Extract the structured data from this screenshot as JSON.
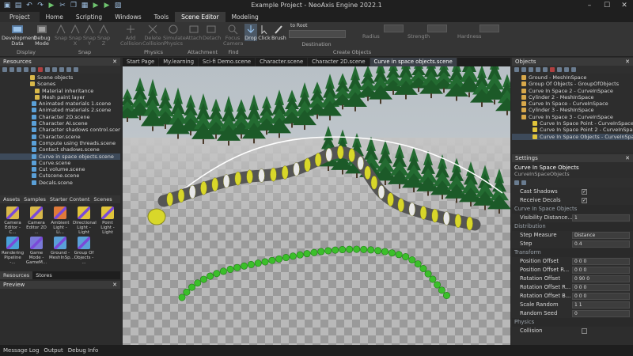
{
  "window": {
    "title": "Example Project - NeoAxis Engine 2022.1"
  },
  "menu": [
    "Project",
    "Home",
    "Scripting",
    "Windows",
    "Tools",
    "Scene Editor",
    "Modeling"
  ],
  "ribbon": {
    "buttons": [
      "Development Data",
      "Debug Mode",
      "Snap",
      "Snap X",
      "Snap Y",
      "Snap Z",
      "Add Collision",
      "Delete Collision",
      "Simulate Physics",
      "Attach",
      "Detach",
      "Focus Camera",
      "Drop",
      "Click",
      "Brush"
    ],
    "destination_value": "to Root",
    "radius_label": "Radius",
    "strength_label": "Strength",
    "hardness_label": "Hardness",
    "groups": [
      "Display",
      "Snap",
      "Physics",
      "Attachment",
      "Find",
      "Destination",
      "Create Objects"
    ]
  },
  "resources": {
    "title": "Resources",
    "items": [
      {
        "label": "Scene objects",
        "kind": "folder"
      },
      {
        "label": "Scenes",
        "kind": "folder"
      },
      {
        "label": "Material inheritance",
        "kind": "folder"
      },
      {
        "label": "Mesh paint layer",
        "kind": "folder"
      },
      {
        "label": "Animated materials 1.scene",
        "kind": "scene"
      },
      {
        "label": "Animated materials 2.scene",
        "kind": "scene"
      },
      {
        "label": "Character 2D.scene",
        "kind": "scene"
      },
      {
        "label": "Character AI.scene",
        "kind": "scene"
      },
      {
        "label": "Character shadows control.scene",
        "kind": "scene"
      },
      {
        "label": "Character.scene",
        "kind": "scene"
      },
      {
        "label": "Compute using threads.scene",
        "kind": "scene"
      },
      {
        "label": "Contact shadows.scene",
        "kind": "scene"
      },
      {
        "label": "Curve in space objects.scene",
        "kind": "scene",
        "selected": true
      },
      {
        "label": "Curve.scene",
        "kind": "scene"
      },
      {
        "label": "Cut volume.scene",
        "kind": "scene"
      },
      {
        "label": "Cutscene.scene",
        "kind": "scene"
      },
      {
        "label": "Decals.scene",
        "kind": "scene"
      }
    ],
    "asset_tabs": [
      "Assets",
      "Samples",
      "Starter Content",
      "Scenes"
    ],
    "assets": [
      {
        "label": "Camera Editor - C..."
      },
      {
        "label": "Camera Editor 2D ..."
      },
      {
        "label": "Ambient Light - Li..."
      },
      {
        "label": "Directional Light - Light"
      },
      {
        "label": "Point Light - Light"
      },
      {
        "label": "Rendering Pipeline -..."
      },
      {
        "label": "Game Mode - GameM..."
      },
      {
        "label": "Ground - MeshInSp..."
      },
      {
        "label": "Group Of Objects - ..."
      }
    ],
    "bottom_tabs": [
      "Resources",
      "Stores"
    ],
    "preview_title": "Preview"
  },
  "doc_tabs": [
    "Start Page",
    "My.learning",
    "Sci-fi Demo.scene",
    "Character.scene",
    "Character 2D.scene",
    "Curve in space objects.scene"
  ],
  "objects": {
    "title": "Objects",
    "items": [
      "Ground - MeshInSpace",
      "Group Of Objects - GroupOfObjects",
      "Curve In Space 2 - CurveInSpace",
      "Cylinder 2 - MeshInSpace",
      "Curve In Space - CurveInSpace",
      "Cylinder 3 - MeshInSpace",
      "Curve In Space 3 - CurveInSpace",
      "Curve In Space Point - CurveInSpacePoint",
      "Curve In Space Point 2 - CurveInSpacePoint",
      "Curve In Space Objects - CurveInSpaceObjects"
    ]
  },
  "settings": {
    "title": "Settings",
    "object_name": "Curve In Space Objects",
    "object_type": "CurveInSpaceObjects",
    "rows": [
      {
        "kind": "check",
        "label": "Cast Shadows",
        "value": "✓"
      },
      {
        "kind": "check",
        "label": "Receive Decals",
        "value": "✓"
      },
      {
        "kind": "cat",
        "label": "Curve In Space Objects"
      },
      {
        "kind": "val",
        "label": "Visibility Distance...",
        "value": "1"
      },
      {
        "kind": "cat",
        "label": "Distribution"
      },
      {
        "kind": "val",
        "label": "Step Measure",
        "value": "Distance"
      },
      {
        "kind": "val",
        "label": "Step",
        "value": "0.4"
      },
      {
        "kind": "cat",
        "label": "Transform"
      },
      {
        "kind": "val",
        "label": "Position Offset",
        "value": "0 0 0"
      },
      {
        "kind": "val",
        "label": "Position Offset R...",
        "value": "0 0 0"
      },
      {
        "kind": "val",
        "label": "Rotation Offset",
        "value": "0 90 0"
      },
      {
        "kind": "val",
        "label": "Rotation Offset R...",
        "value": "0 0 0"
      },
      {
        "kind": "val",
        "label": "Rotation Offset B...",
        "value": "0 0 0"
      },
      {
        "kind": "val",
        "label": "Scale Random",
        "value": "1 1"
      },
      {
        "kind": "val",
        "label": "Random Seed",
        "value": "0"
      },
      {
        "kind": "cat",
        "label": "Physics"
      },
      {
        "kind": "check",
        "label": "Collision",
        "value": ""
      }
    ]
  },
  "status": [
    "Message Log",
    "Output",
    "Debug Info"
  ],
  "colors": {
    "accent": "#3d4a5a",
    "tree_green": "#1f6b2e",
    "curve_yellow": "#d8d72a",
    "ball_green": "#3bbf2a"
  }
}
